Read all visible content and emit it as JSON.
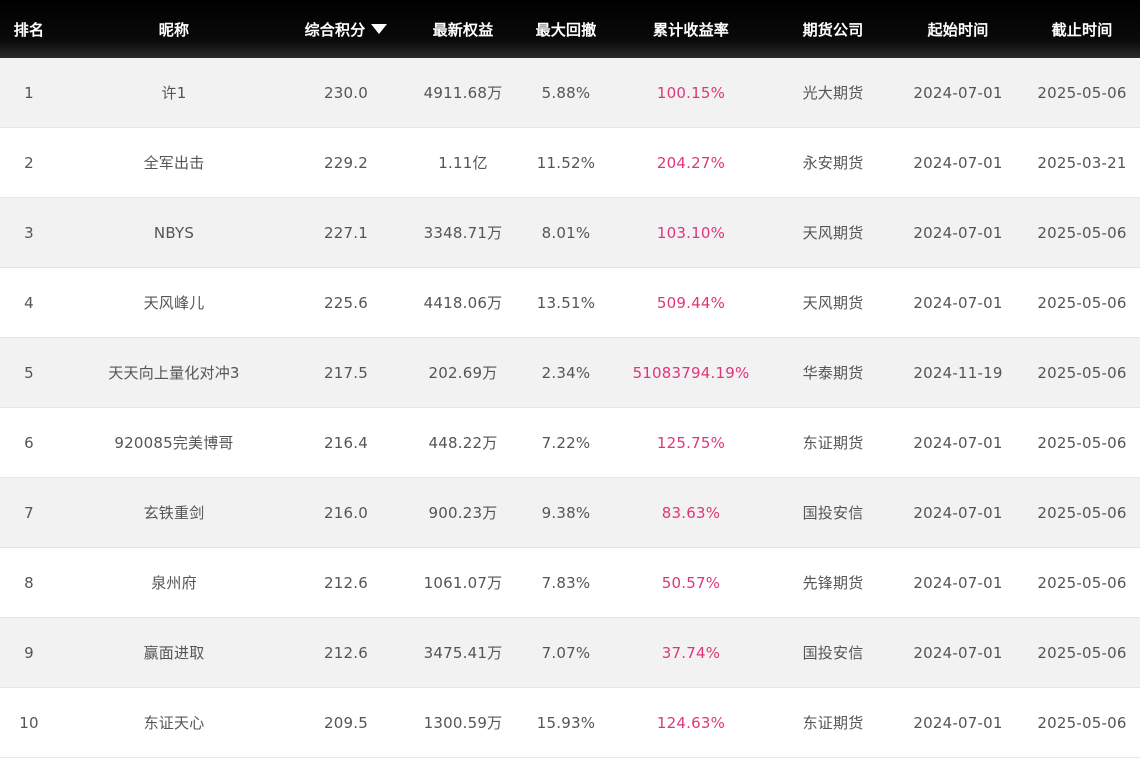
{
  "headers": {
    "rank": "排名",
    "nickname": "昵称",
    "score": "综合积分",
    "equity": "最新权益",
    "drawdown": "最大回撤",
    "return": "累计收益率",
    "company": "期货公司",
    "start": "起始时间",
    "end": "截止时间"
  },
  "sort_icon": "caret-down-icon",
  "colors": {
    "header_bg": "#000000",
    "return_text": "#e0357a",
    "row_alt": "#f2f2f2"
  },
  "rows": [
    {
      "rank": "1",
      "nickname": "许1",
      "score": "230.0",
      "equity": "4911.68万",
      "drawdown": "5.88%",
      "return": "100.15%",
      "company": "光大期货",
      "start": "2024-07-01",
      "end": "2025-05-06"
    },
    {
      "rank": "2",
      "nickname": "全军出击",
      "score": "229.2",
      "equity": "1.11亿",
      "drawdown": "11.52%",
      "return": "204.27%",
      "company": "永安期货",
      "start": "2024-07-01",
      "end": "2025-03-21"
    },
    {
      "rank": "3",
      "nickname": "NBYS",
      "score": "227.1",
      "equity": "3348.71万",
      "drawdown": "8.01%",
      "return": "103.10%",
      "company": "天风期货",
      "start": "2024-07-01",
      "end": "2025-05-06"
    },
    {
      "rank": "4",
      "nickname": "天风峰儿",
      "score": "225.6",
      "equity": "4418.06万",
      "drawdown": "13.51%",
      "return": "509.44%",
      "company": "天风期货",
      "start": "2024-07-01",
      "end": "2025-05-06"
    },
    {
      "rank": "5",
      "nickname": "天天向上量化对冲3",
      "score": "217.5",
      "equity": "202.69万",
      "drawdown": "2.34%",
      "return": "51083794.19%",
      "company": "华泰期货",
      "start": "2024-11-19",
      "end": "2025-05-06"
    },
    {
      "rank": "6",
      "nickname": "920085完美博哥",
      "score": "216.4",
      "equity": "448.22万",
      "drawdown": "7.22%",
      "return": "125.75%",
      "company": "东证期货",
      "start": "2024-07-01",
      "end": "2025-05-06"
    },
    {
      "rank": "7",
      "nickname": "玄铁重剑",
      "score": "216.0",
      "equity": "900.23万",
      "drawdown": "9.38%",
      "return": "83.63%",
      "company": "国投安信",
      "start": "2024-07-01",
      "end": "2025-05-06"
    },
    {
      "rank": "8",
      "nickname": "泉州府",
      "score": "212.6",
      "equity": "1061.07万",
      "drawdown": "7.83%",
      "return": "50.57%",
      "company": "先锋期货",
      "start": "2024-07-01",
      "end": "2025-05-06"
    },
    {
      "rank": "9",
      "nickname": "赢面进取",
      "score": "212.6",
      "equity": "3475.41万",
      "drawdown": "7.07%",
      "return": "37.74%",
      "company": "国投安信",
      "start": "2024-07-01",
      "end": "2025-05-06"
    },
    {
      "rank": "10",
      "nickname": "东证天心",
      "score": "209.5",
      "equity": "1300.59万",
      "drawdown": "15.93%",
      "return": "124.63%",
      "company": "东证期货",
      "start": "2024-07-01",
      "end": "2025-05-06"
    }
  ]
}
